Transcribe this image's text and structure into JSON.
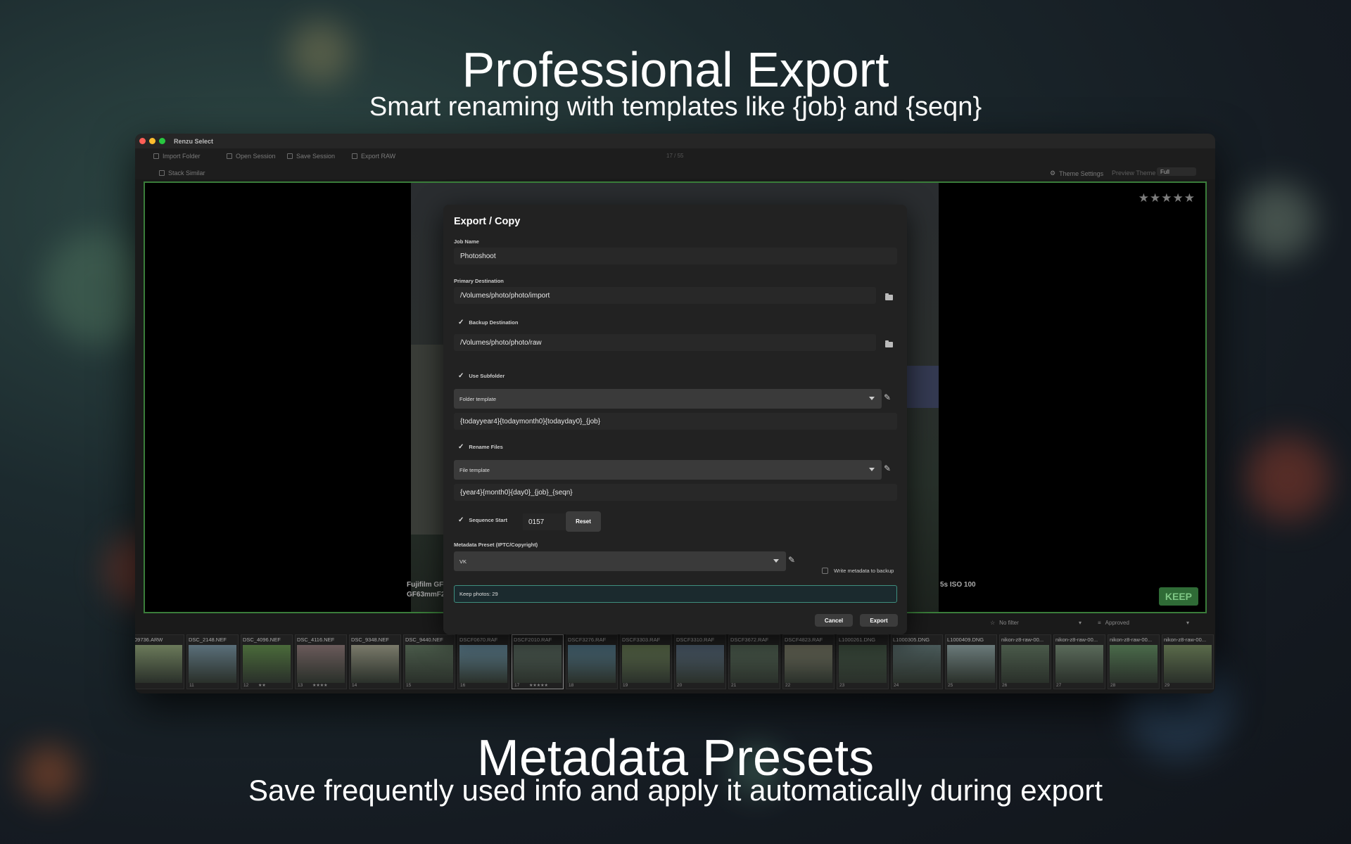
{
  "marketing": {
    "headline1": "Professional Export",
    "subline1": "Smart renaming with templates like {job} and {seqn}",
    "headline2": "Metadata Presets",
    "subline2": "Save frequently used info and apply it automatically during export"
  },
  "window": {
    "title": "Renzu Select",
    "traffic_lights": [
      "#ff5f57",
      "#febc2e",
      "#28c840"
    ]
  },
  "toolbar": {
    "import_folder": "Import Folder",
    "open_session": "Open Session",
    "save_session": "Save Session",
    "export_raw": "Export RAW",
    "counter": "17 / 55",
    "stack_similar": "Stack Similar",
    "theme_settings": "Theme Settings",
    "preview_theme_label": "Preview Theme",
    "preview_theme_value": "Full"
  },
  "viewer": {
    "stars": "★★★★★",
    "keep_label": "KEEP",
    "camera_line1": "Fujifilm GF",
    "camera_line2": "GF63mmF2",
    "exposure_fragment": "5s ISO 100"
  },
  "filters": {
    "rating_filter": "No filter",
    "status_filter": "Approved"
  },
  "filmstrip": [
    {
      "name": "09736.ARW",
      "num": "",
      "stars": ""
    },
    {
      "name": "DSC_2148.NEF",
      "num": "11",
      "stars": ""
    },
    {
      "name": "DSC_4096.NEF",
      "num": "12",
      "stars": "★★"
    },
    {
      "name": "DSC_4116.NEF",
      "num": "13",
      "stars": "★★★★"
    },
    {
      "name": "DSC_9348.NEF",
      "num": "14",
      "stars": ""
    },
    {
      "name": "DSC_9440.NEF",
      "num": "15",
      "stars": ""
    },
    {
      "name": "DSCF0670.RAF",
      "num": "16",
      "stars": ""
    },
    {
      "name": "DSCF2010.RAF",
      "num": "17",
      "stars": "★★★★★"
    },
    {
      "name": "DSCF3276.RAF",
      "num": "18",
      "stars": ""
    },
    {
      "name": "DSCF3303.RAF",
      "num": "19",
      "stars": ""
    },
    {
      "name": "DSCF3310.RAF",
      "num": "20",
      "stars": ""
    },
    {
      "name": "DSCF3672.RAF",
      "num": "21",
      "stars": ""
    },
    {
      "name": "DSCF4823.RAF",
      "num": "22",
      "stars": ""
    },
    {
      "name": "L1000261.DNG",
      "num": "23",
      "stars": ""
    },
    {
      "name": "L1000305.DNG",
      "num": "24",
      "stars": ""
    },
    {
      "name": "L1000409.DNG",
      "num": "25",
      "stars": ""
    },
    {
      "name": "nikon-z8-raw-00...",
      "num": "26",
      "stars": ""
    },
    {
      "name": "nikon-z8-raw-00...",
      "num": "27",
      "stars": ""
    },
    {
      "name": "nikon-z8-raw-00...",
      "num": "28",
      "stars": ""
    },
    {
      "name": "nikon-z8-raw-00...",
      "num": "29",
      "stars": ""
    }
  ],
  "dialog": {
    "title": "Export / Copy",
    "job_name_label": "Job Name",
    "job_name_value": "Photoshoot",
    "primary_dest_label": "Primary Destination",
    "primary_dest_value": "/Volumes/photo/photo/import",
    "backup_dest_label": "Backup Destination",
    "backup_dest_value": "/Volumes/photo/photo/raw",
    "use_subfolder_label": "Use Subfolder",
    "folder_template_select": "Folder template",
    "folder_template_value": "{todayyear4}{todaymonth0}{todayday0}_{job}",
    "rename_files_label": "Rename Files",
    "file_template_select": "File template",
    "file_template_value": "{year4}{month0}{day0}_{job}_{seqn}",
    "sequence_start_label": "Sequence Start",
    "sequence_start_value": "0157",
    "reset_label": "Reset",
    "metadata_preset_label": "Metadata Preset (IPTC/Copyright)",
    "metadata_preset_value": "VK",
    "write_metadata_label": "Write metadata to backup",
    "keep_photos_text": "Keep photos: 29",
    "cancel_label": "Cancel",
    "export_label": "Export"
  }
}
